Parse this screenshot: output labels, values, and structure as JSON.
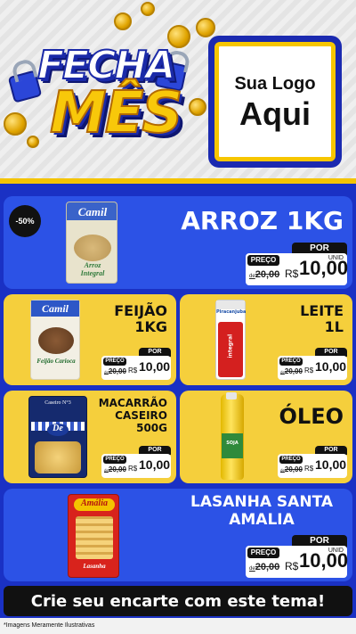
{
  "header": {
    "title_line1": "FECHA",
    "title_line2": "MÊS",
    "logo_line1": "Sua Logo",
    "logo_line2": "Aqui"
  },
  "products": [
    {
      "name": "ARROZ 1KG",
      "brand": "Camil",
      "package_text": "Arroz Integral",
      "discount": "-50%",
      "por": "POR",
      "preco": "PREÇO",
      "old_price_prefix": "de",
      "old_price": "20,00",
      "currency": "R$",
      "price": "10,00",
      "unit": "UNID"
    },
    {
      "name_line1": "FEIJÃO",
      "name_line2": "1KG",
      "brand": "Camil",
      "package_text": "Feijão Carioca",
      "por": "POR",
      "preco": "PREÇO",
      "old_price_prefix": "de",
      "old_price": "20,00",
      "currency": "R$",
      "price": "10,00",
      "unit": "UNID"
    },
    {
      "name_line1": "LEITE",
      "name_line2": "1L",
      "brand": "Piracanjuba",
      "package_text": "integral",
      "por": "POR",
      "preco": "PREÇO",
      "old_price_prefix": "de",
      "old_price": "20,00",
      "currency": "R$",
      "price": "10,00",
      "unit": "UNID"
    },
    {
      "name_line1": "MACARRÃO",
      "name_line2": "CASEIRO",
      "name_line3": "500G",
      "brand": "De",
      "package_text": "Caseiro N°3",
      "por": "POR",
      "preco": "PREÇO",
      "old_price_prefix": "de",
      "old_price": "20,00",
      "currency": "R$",
      "price": "10,00",
      "unit": "UNID"
    },
    {
      "name": "ÓLEO",
      "package_text": "SOJA",
      "por": "POR",
      "preco": "PREÇO",
      "old_price_prefix": "de",
      "old_price": "20,00",
      "currency": "R$",
      "price": "10,00",
      "unit": "UNID"
    },
    {
      "name_line1": "LASANHA SANTA",
      "name_line2": "AMALIA",
      "brand": "Amália",
      "package_text": "Lasanha",
      "por": "POR",
      "preco": "PREÇO",
      "old_price_prefix": "de",
      "old_price": "20,00",
      "currency": "R$",
      "price": "10,00",
      "unit": "UNID"
    }
  ],
  "cta": "Crie seu encarte com este tema!",
  "footnote": "*Imagens Meramente Ilustrativas",
  "colors": {
    "main_blue": "#1a31c4",
    "card_blue": "#2c52e6",
    "card_yellow": "#f5cf3c",
    "accent_yellow": "#f7c600"
  }
}
